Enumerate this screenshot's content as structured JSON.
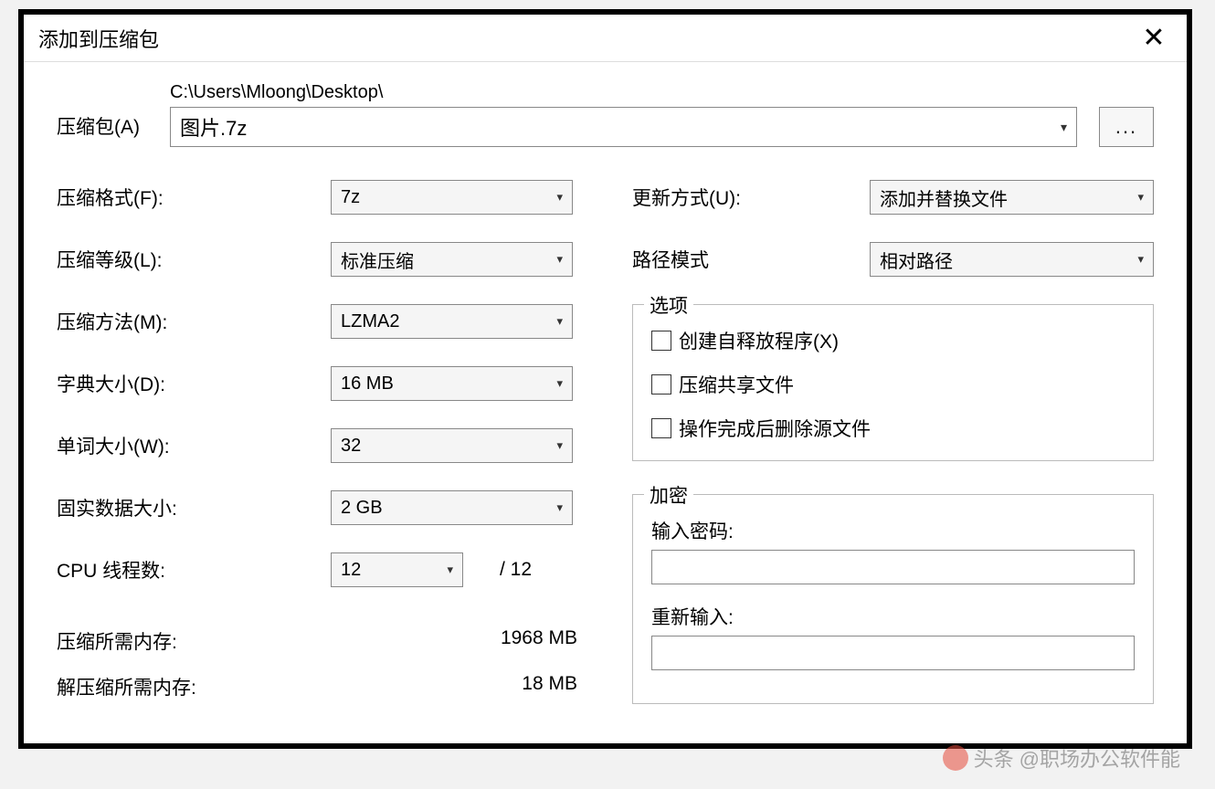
{
  "window": {
    "title": "添加到压缩包",
    "close_icon": "✕"
  },
  "archive": {
    "label": "压缩包(A)",
    "path": "C:\\Users\\Mloong\\Desktop\\",
    "filename": "图片.7z",
    "browse": "..."
  },
  "left": {
    "format": {
      "label": "压缩格式(F):",
      "value": "7z"
    },
    "level": {
      "label": "压缩等级(L):",
      "value": "标准压缩"
    },
    "method": {
      "label": "压缩方法(M):",
      "value": "LZMA2"
    },
    "dict": {
      "label": "字典大小(D):",
      "value": "16 MB"
    },
    "word": {
      "label": "单词大小(W):",
      "value": "32"
    },
    "solid": {
      "label": "固实数据大小:",
      "value": "2 GB"
    },
    "cpu": {
      "label": "CPU 线程数:",
      "value": "12",
      "suffix": "/ 12"
    },
    "mem_compress": {
      "label": "压缩所需内存:",
      "value": "1968 MB"
    },
    "mem_decompress": {
      "label": "解压缩所需内存:",
      "value": "18 MB"
    }
  },
  "right": {
    "update": {
      "label": "更新方式(U):",
      "value": "添加并替换文件"
    },
    "pathmode": {
      "label": "路径模式",
      "value": "相对路径"
    },
    "options": {
      "legend": "选项",
      "sfx": "创建自释放程序(X)",
      "shared": "压缩共享文件",
      "delete_after": "操作完成后删除源文件"
    },
    "encrypt": {
      "legend": "加密",
      "password_label": "输入密码:",
      "password": "",
      "confirm_label": "重新输入:",
      "confirm": ""
    }
  },
  "watermark": {
    "prefix": "头条",
    "text": "@职场办公软件能"
  }
}
